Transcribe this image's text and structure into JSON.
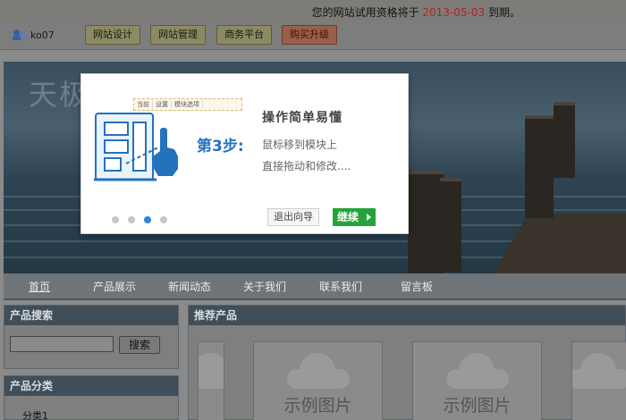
{
  "notice": {
    "prefix": "您的网站试用资格将于",
    "date": "2013-05-03",
    "suffix": "到期。"
  },
  "user": {
    "name": "ko07"
  },
  "toolbar": {
    "buttons": [
      "网站设计",
      "网站管理",
      "商务平台",
      "购买升级"
    ]
  },
  "banner": {
    "logo": "天极"
  },
  "nav": {
    "items": [
      "首页",
      "产品展示",
      "新闻动态",
      "关于我们",
      "联系我们",
      "留言板"
    ],
    "active": "首页"
  },
  "sidebar": {
    "search": {
      "title": "产品搜索",
      "button": "搜索",
      "value": ""
    },
    "category": {
      "title": "产品分类",
      "items": [
        "分类1"
      ]
    }
  },
  "recommended": {
    "title": "推荐产品",
    "thumb_label": "示例图片"
  },
  "guide": {
    "mini_bar": [
      "当前",
      "设置",
      "模块选项"
    ],
    "step": "第3步",
    "colon": ":",
    "title": "操作简单易懂",
    "line1": "鼠标移到模块上",
    "line2": "直接拖动和修改....",
    "exit": "退出向导",
    "next": "继续",
    "current_step": 3,
    "total_steps": 4
  },
  "colors": {
    "accent_blue": "#2472be",
    "next_green": "#25a33a",
    "date_red": "#b5241d"
  },
  "icons": {
    "user": "users-icon",
    "illustration": "drag-module-icon",
    "next_arrow": "play-arrow-icon"
  }
}
